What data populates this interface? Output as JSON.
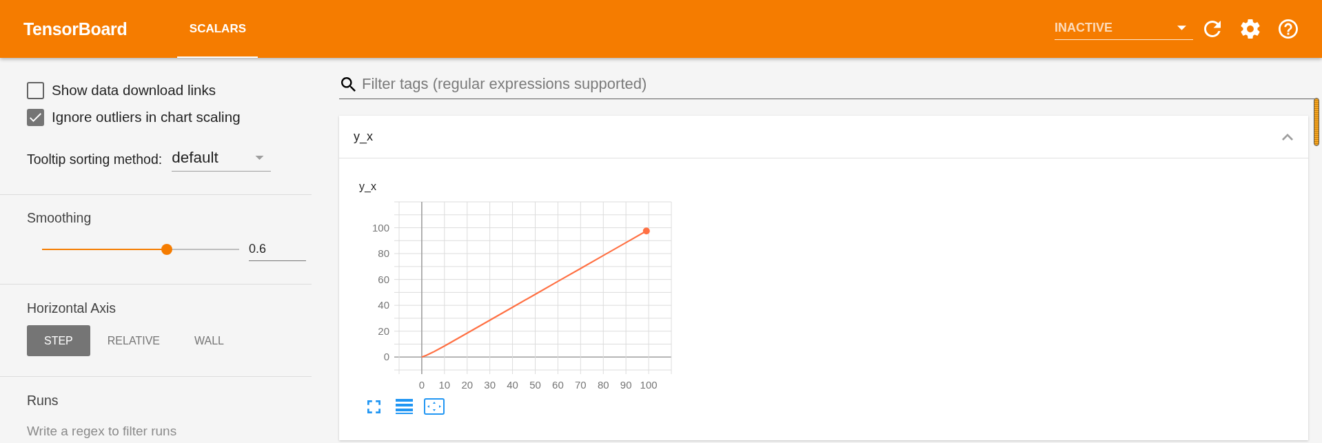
{
  "header": {
    "title": "TensorBoard",
    "tabs": [
      {
        "label": "SCALARS",
        "selected": true
      }
    ],
    "run_selector": {
      "value": "INACTIVE"
    }
  },
  "sidebar": {
    "checkboxes": [
      {
        "label": "Show data download links",
        "checked": false
      },
      {
        "label": "Ignore outliers in chart scaling",
        "checked": true
      }
    ],
    "tooltip_sorting": {
      "label": "Tooltip sorting method:",
      "value": "default"
    },
    "smoothing": {
      "label": "Smoothing",
      "level": 0.6,
      "reading": "0.6"
    },
    "horizontal_axis": {
      "label": "Horizontal Axis",
      "options": [
        {
          "label": "STEP",
          "selected": true
        },
        {
          "label": "RELATIVE",
          "selected": false
        },
        {
          "label": "WALL",
          "selected": false
        }
      ]
    },
    "runs": {
      "label": "Runs",
      "placeholder": "Write a regex to filter runs"
    }
  },
  "main": {
    "tag_filter": {
      "placeholder": "Filter tags (regular expressions supported)"
    },
    "cards": [
      {
        "title": "y_x",
        "expanded": true,
        "chart": {
          "chart_data": {
            "type": "line",
            "title": "y_x",
            "x": [
              0,
              2,
              5,
              10,
              20,
              30,
              40,
              50,
              60,
              70,
              80,
              90,
              99
            ],
            "series": [
              {
                "color": "#ff7043",
                "values": [
                  0,
                  1.3,
                  3.8,
                  8.5,
                  18.5,
                  28.5,
                  38.5,
                  48.5,
                  58.5,
                  68.5,
                  78.5,
                  88.5,
                  97.5
                ]
              }
            ],
            "xlim": [
              -10,
              110
            ],
            "ylim": [
              -10,
              120
            ],
            "xticks": [
              0,
              10,
              20,
              30,
              40,
              50,
              60,
              70,
              80,
              90,
              100
            ],
            "yticks": [
              0,
              20,
              40,
              60,
              80,
              100
            ],
            "grid": true
          }
        }
      }
    ]
  }
}
